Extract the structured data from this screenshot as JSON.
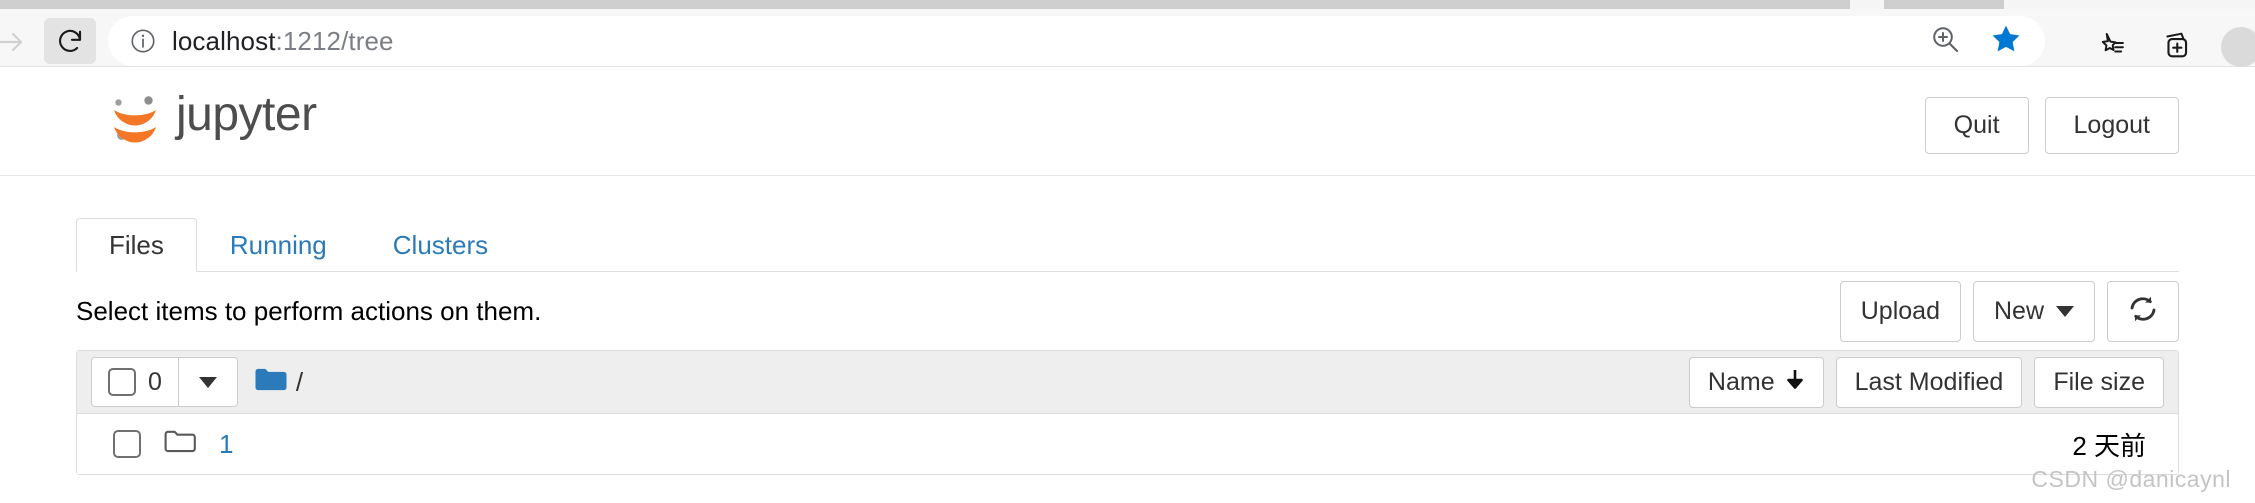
{
  "browser": {
    "url_host": "localhost",
    "url_rest": ":1212/tree",
    "icons": {
      "forward": "forward-arrow-icon",
      "reload": "reload-icon",
      "info": "site-info-icon",
      "zoom": "zoom-in-icon",
      "bookmark_star": "bookmark-star-filled-icon",
      "favorites": "favorites-icon",
      "collections": "collections-icon",
      "profile": "profile-avatar-icon"
    }
  },
  "jupyter": {
    "logo_text": "jupyter",
    "header_buttons": [
      {
        "label": "Quit"
      },
      {
        "label": "Logout"
      }
    ],
    "tabs": [
      {
        "label": "Files",
        "active": true
      },
      {
        "label": "Running",
        "active": false
      },
      {
        "label": "Clusters",
        "active": false
      }
    ],
    "action_bar": {
      "text": "Select items to perform actions on them.",
      "upload_label": "Upload",
      "new_label": "New",
      "refresh_icon": "refresh-icon"
    },
    "list_header": {
      "select_count": "0",
      "folder_icon": "folder-filled-icon",
      "breadcrumb_root": "/",
      "sort_buttons": [
        {
          "label": "Name",
          "arrow": "↓"
        },
        {
          "label": "Last Modified",
          "arrow": ""
        },
        {
          "label": "File size",
          "arrow": ""
        }
      ]
    },
    "rows": [
      {
        "name": "1",
        "icon": "folder-outline-icon",
        "modified": "2 天前",
        "size": ""
      }
    ]
  },
  "watermark": "CSDN @danicaynl",
  "colors": {
    "link_blue": "#2b7bba",
    "jupyter_orange": "#f37726",
    "folder_blue": "#2b7bba",
    "star_blue": "#0078d4"
  }
}
